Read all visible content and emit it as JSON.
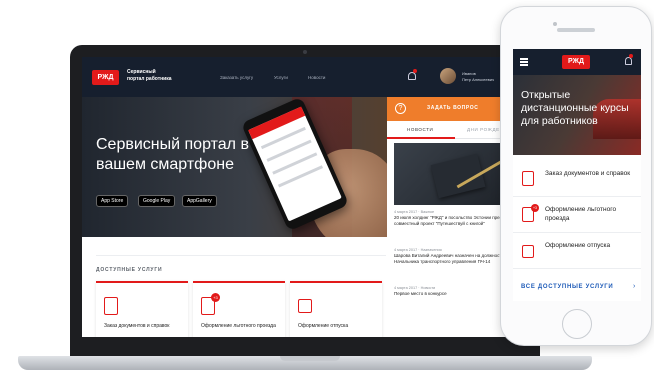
{
  "laptop": {
    "header": {
      "logo": "РЖД",
      "title_line1": "Сервисный",
      "title_line2": "портал работника",
      "nav": [
        "Заказать услугу",
        "Услуги",
        "Новости"
      ],
      "user_line1": "Иванов",
      "user_line2": "Петр Алексеевич"
    },
    "hero": {
      "title": "Сервисный портал в вашем смартфоне",
      "stores": [
        "App Store",
        "Google Play",
        "AppGallery"
      ]
    },
    "sidebar": {
      "ask_button": "ЗАДАТЬ ВОПРОС",
      "tabs": [
        "НОВОСТИ",
        "ДНИ РОЖДЕНИЯ"
      ],
      "news": [
        {
          "date": "4 марта 2017 · Важное",
          "text": "20 июля холдинг \"РЖД\" и посольство Эстонии презентуют совместный проект \"Путешествуй с книгой\""
        },
        {
          "date": "4 марта 2017 · Назначения",
          "text": "Шарова Виталий Андреевич назначен на должность Начальника транспортного управления ПЧ-14"
        },
        {
          "date": "4 марта 2017 · Новости",
          "text": "Первое место в конкурсе"
        }
      ]
    },
    "services": {
      "heading": "ДОСТУПНЫЕ УСЛУГИ",
      "cards": [
        {
          "label": "Заказ документов и справок",
          "badge": ""
        },
        {
          "label": "Оформление льготного проезда",
          "badge": "+3"
        },
        {
          "label": "Оформление отпуска",
          "badge": ""
        }
      ]
    }
  },
  "phone": {
    "logo": "РЖД",
    "hero_title": "Открытые дистанционные курсы для работников",
    "items": [
      {
        "label": "Заказ документов и справок",
        "badge": ""
      },
      {
        "label": "Оформление льготного проезда",
        "badge": "+3"
      },
      {
        "label": "Оформление отпуска",
        "badge": ""
      }
    ],
    "all_services": "ВСЕ ДОСТУПНЫЕ УСЛУГИ",
    "arrow": "›"
  },
  "colors": {
    "brand_red": "#e21a1a",
    "header_navy": "#161f2e",
    "accent_orange": "#ef7d2b",
    "link_blue": "#1e5bb8"
  }
}
